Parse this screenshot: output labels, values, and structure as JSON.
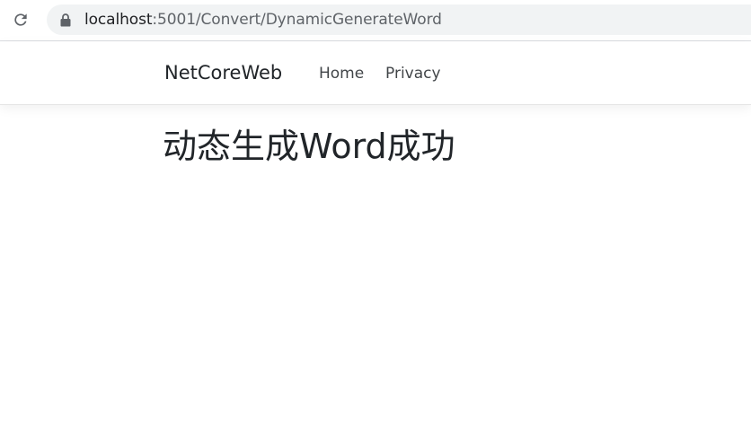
{
  "browser": {
    "url_host": "localhost",
    "url_path": ":5001/Convert/DynamicGenerateWord",
    "icons": [
      "reload-icon",
      "lock-icon"
    ]
  },
  "navbar": {
    "brand": "NetCoreWeb",
    "links": [
      {
        "label": "Home"
      },
      {
        "label": "Privacy"
      }
    ]
  },
  "main": {
    "heading": "动态生成Word成功"
  },
  "colors": {
    "text": "#212529",
    "omnibox_bg": "#f1f3f4",
    "url_path": "#5f6368"
  }
}
